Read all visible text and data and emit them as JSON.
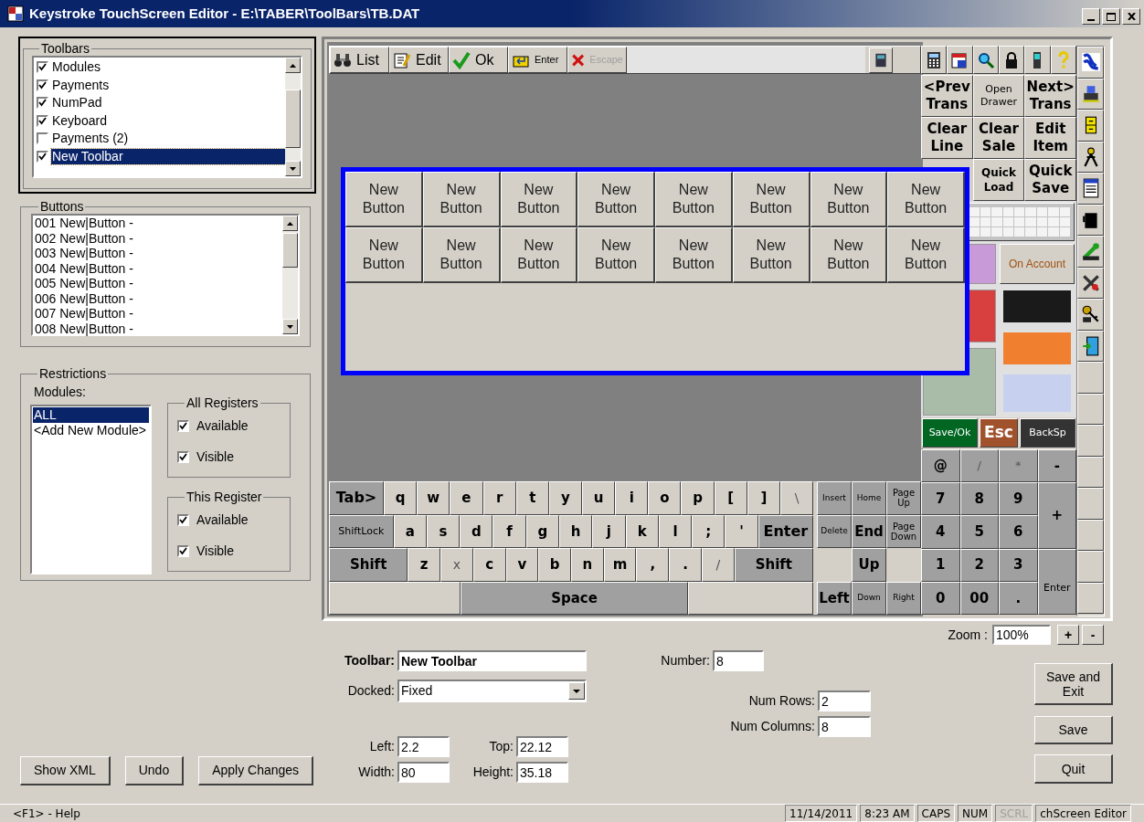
{
  "window": {
    "title": "Keystroke TouchScreen Editor - E:\\TABER\\ToolBars\\TB.DAT"
  },
  "toolbars": {
    "title": "Toolbars",
    "items": [
      {
        "label": "Modules",
        "checked": true,
        "selected": false
      },
      {
        "label": "Payments",
        "checked": true,
        "selected": false
      },
      {
        "label": "NumPad",
        "checked": true,
        "selected": false
      },
      {
        "label": "Keyboard",
        "checked": true,
        "selected": false
      },
      {
        "label": "Payments (2)",
        "checked": false,
        "selected": false
      },
      {
        "label": "New Toolbar",
        "checked": true,
        "selected": true
      }
    ]
  },
  "buttons_list": {
    "title": "Buttons",
    "items": [
      "001 New|Button -",
      "002 New|Button -",
      "003 New|Button -",
      "004 New|Button -",
      "005 New|Button -",
      "006 New|Button -",
      "007 New|Button -",
      "008 New|Button -"
    ]
  },
  "restrictions": {
    "title": "Restrictions",
    "modules_label": "Modules:",
    "modules": [
      {
        "label": "ALL",
        "selected": true
      },
      {
        "label": "<Add New Module>",
        "selected": false
      }
    ],
    "groups": [
      {
        "title": "All Registers",
        "checks": [
          {
            "label": "Available",
            "checked": true
          },
          {
            "label": "Visible",
            "checked": true
          }
        ]
      },
      {
        "title": "This Register",
        "checks": [
          {
            "label": "Available",
            "checked": true
          },
          {
            "label": "Visible",
            "checked": true
          }
        ]
      }
    ]
  },
  "actions": [
    {
      "label": "Show XML"
    },
    {
      "label": "Undo"
    },
    {
      "label": "Apply Changes"
    }
  ],
  "preview": {
    "top_toolbar": [
      {
        "label": "List",
        "kind": "normal",
        "disabled": false
      },
      {
        "label": "Edit",
        "kind": "normal",
        "disabled": false
      },
      {
        "label": "Ok",
        "kind": "normal",
        "disabled": false
      },
      {
        "label": "Enter",
        "kind": "small",
        "disabled": false
      },
      {
        "label": "Escape",
        "kind": "small",
        "disabled": true
      }
    ],
    "module_rows": [
      [
        {
          "label": "<Prev Trans",
          "kind": "bold"
        },
        {
          "label": "Open Drawer",
          "kind": "plain"
        },
        {
          "label": "Next> Trans",
          "kind": "bold"
        }
      ],
      [
        {
          "label": "Clear Line",
          "kind": "bold"
        },
        {
          "label": "Clear Sale",
          "kind": "bold"
        },
        {
          "label": "Edit Item",
          "kind": "bold"
        }
      ],
      [
        {
          "label": "Quick Load",
          "kind": "bold-small"
        },
        {
          "label": "Quick Save",
          "kind": "bold"
        }
      ]
    ],
    "on_account": "On Account",
    "func_keys": [
      {
        "label": "Save/Ok",
        "kind": "small",
        "color": "#006622"
      },
      {
        "label": "Esc",
        "kind": "big",
        "color": "#a0522d"
      },
      {
        "label": "BackSp",
        "kind": "small",
        "color": "#333333"
      }
    ],
    "numpad": [
      {
        "label": "@",
        "kind": "key"
      },
      {
        "label": "/",
        "kind": "faint"
      },
      {
        "label": "*",
        "kind": "faint"
      },
      {
        "label": "-",
        "kind": "key"
      },
      {
        "label": "7",
        "kind": "key"
      },
      {
        "label": "8",
        "kind": "key"
      },
      {
        "label": "9",
        "kind": "key"
      },
      {
        "label": "+",
        "kind": "tall"
      },
      {
        "label": "4",
        "kind": "key"
      },
      {
        "label": "5",
        "kind": "key"
      },
      {
        "label": "6",
        "kind": "key"
      },
      {
        "label": "1",
        "kind": "key"
      },
      {
        "label": "2",
        "kind": "key"
      },
      {
        "label": "3",
        "kind": "key"
      },
      {
        "label": "Enter",
        "kind": "tall-small"
      },
      {
        "label": "0",
        "kind": "key"
      },
      {
        "label": "00",
        "kind": "key"
      },
      {
        "label": ".",
        "kind": "key"
      }
    ],
    "keyboard": [
      [
        {
          "label": "Tab>",
          "kind": "mod"
        },
        {
          "label": "q",
          "kind": "key"
        },
        {
          "label": "w",
          "kind": "key"
        },
        {
          "label": "e",
          "kind": "key"
        },
        {
          "label": "r",
          "kind": "key"
        },
        {
          "label": "t",
          "kind": "key"
        },
        {
          "label": "y",
          "kind": "key"
        },
        {
          "label": "u",
          "kind": "key"
        },
        {
          "label": "i",
          "kind": "key"
        },
        {
          "label": "o",
          "kind": "key"
        },
        {
          "label": "p",
          "kind": "key"
        },
        {
          "label": "[",
          "kind": "key"
        },
        {
          "label": "]",
          "kind": "key"
        },
        {
          "label": "\\",
          "kind": "faint"
        }
      ],
      [
        {
          "label": "ShiftLock",
          "kind": "mod-small"
        },
        {
          "label": "a",
          "kind": "key"
        },
        {
          "label": "s",
          "kind": "key"
        },
        {
          "label": "d",
          "kind": "key"
        },
        {
          "label": "f",
          "kind": "key"
        },
        {
          "label": "g",
          "kind": "key"
        },
        {
          "label": "h",
          "kind": "key"
        },
        {
          "label": "j",
          "kind": "key"
        },
        {
          "label": "k",
          "kind": "key"
        },
        {
          "label": "l",
          "kind": "key"
        },
        {
          "label": ";",
          "kind": "key"
        },
        {
          "label": "'",
          "kind": "key"
        },
        {
          "label": "Enter",
          "kind": "mod"
        }
      ],
      [
        {
          "label": "Shift",
          "kind": "mod-wide"
        },
        {
          "label": "z",
          "kind": "key"
        },
        {
          "label": "x",
          "kind": "faint"
        },
        {
          "label": "c",
          "kind": "key"
        },
        {
          "label": "v",
          "kind": "key"
        },
        {
          "label": "b",
          "kind": "key"
        },
        {
          "label": "n",
          "kind": "key"
        },
        {
          "label": "m",
          "kind": "key"
        },
        {
          "label": ",",
          "kind": "key"
        },
        {
          "label": ".",
          "kind": "key"
        },
        {
          "label": "/",
          "kind": "faint"
        },
        {
          "label": "Shift",
          "kind": "mod-wide"
        }
      ],
      [
        {
          "label": "Space",
          "kind": "space"
        }
      ]
    ],
    "nav_keys": [
      [
        {
          "label": "Insert",
          "kind": "tiny"
        },
        {
          "label": "Home",
          "kind": "tiny"
        },
        {
          "label": "Page Up",
          "kind": "small"
        }
      ],
      [
        {
          "label": "Delete",
          "kind": "tiny"
        },
        {
          "label": "End",
          "kind": "big"
        },
        {
          "label": "Page Down",
          "kind": "small"
        }
      ],
      [
        {
          "label": "Up",
          "kind": "big"
        }
      ],
      [
        {
          "label": "Left",
          "kind": "big"
        },
        {
          "label": "Down",
          "kind": "tiny"
        },
        {
          "label": "Right",
          "kind": "tiny"
        }
      ]
    ],
    "new_toolbar": [
      "New Button",
      "New Button",
      "New Button",
      "New Button",
      "New Button",
      "New Button",
      "New Button",
      "New Button",
      "New Button",
      "New Button",
      "New Button",
      "New Button",
      "New Button",
      "New Button",
      "New Button",
      "New Button"
    ]
  },
  "zoom": {
    "label": "Zoom :",
    "value": "100%",
    "buttons": [
      "+",
      "-"
    ]
  },
  "form": {
    "toolbar": {
      "label": "Toolbar:",
      "value": "New Toolbar"
    },
    "docked": {
      "label": "Docked:",
      "value": "Fixed"
    },
    "number": {
      "label": "Number:",
      "value": "8"
    },
    "num_rows": {
      "label": "Num Rows:",
      "value": "2"
    },
    "num_columns": {
      "label": "Num Columns:",
      "value": "8"
    },
    "left": {
      "label": "Left:",
      "value": "2.2"
    },
    "top": {
      "label": "Top:",
      "value": "22.12"
    },
    "width": {
      "label": "Width:",
      "value": "80"
    },
    "height": {
      "label": "Height:",
      "value": "35.18"
    }
  },
  "side_buttons": [
    {
      "label": "Save and Exit"
    },
    {
      "label": "Save"
    },
    {
      "label": "Quit"
    }
  ],
  "status_bar": {
    "help": "<F1> - Help",
    "panels": [
      {
        "text": "11/14/2011",
        "disabled": false
      },
      {
        "text": "8:23 AM",
        "disabled": false
      },
      {
        "text": "CAPS",
        "disabled": false
      },
      {
        "text": "NUM",
        "disabled": false
      },
      {
        "text": "SCRL",
        "disabled": true
      },
      {
        "text": "chScreen Editor",
        "disabled": false
      }
    ]
  }
}
